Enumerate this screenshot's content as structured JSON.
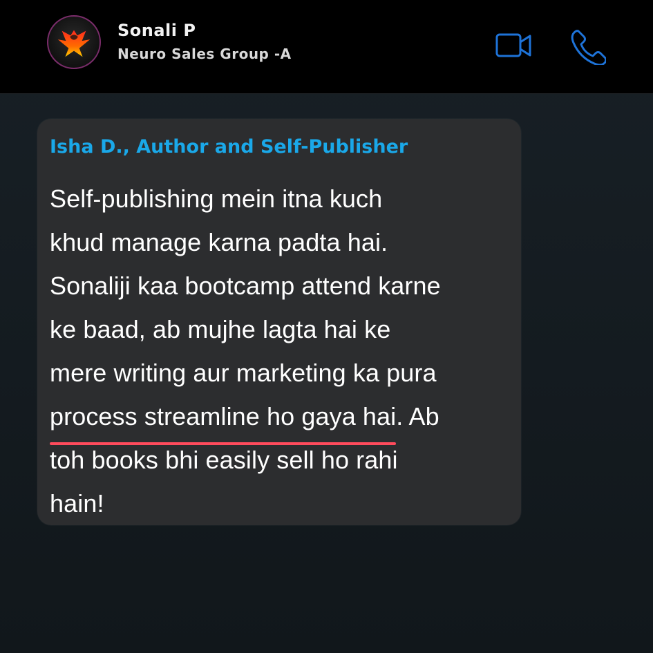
{
  "header": {
    "name": "Sonali P",
    "subtitle": "Neuro Sales Group -A",
    "avatar_icon": "phoenix-logo",
    "video_icon": "video-call-icon",
    "phone_icon": "phone-icon",
    "accent_color": "#1e73d8"
  },
  "message": {
    "sender": "Isha D., Author and Self-Publisher",
    "lines": [
      " Self-publishing mein itna kuch",
      "khud manage karna padta hai.",
      "Sonaliji kaa bootcamp attend karne",
      "ke baad, ab mujhe lagta hai ke",
      "mere writing aur marketing ka pura"
    ],
    "underlined_text": "process streamline ho gaya hai",
    "after_underlined_text": ". Ab",
    "line_7": "toh books bhi easily sell ho rahi",
    "line_8": "hain!"
  },
  "colors": {
    "sender_color": "#1aa8e9",
    "underline_color": "#ff4b5c",
    "bubble_color": "#2c2d2f"
  }
}
